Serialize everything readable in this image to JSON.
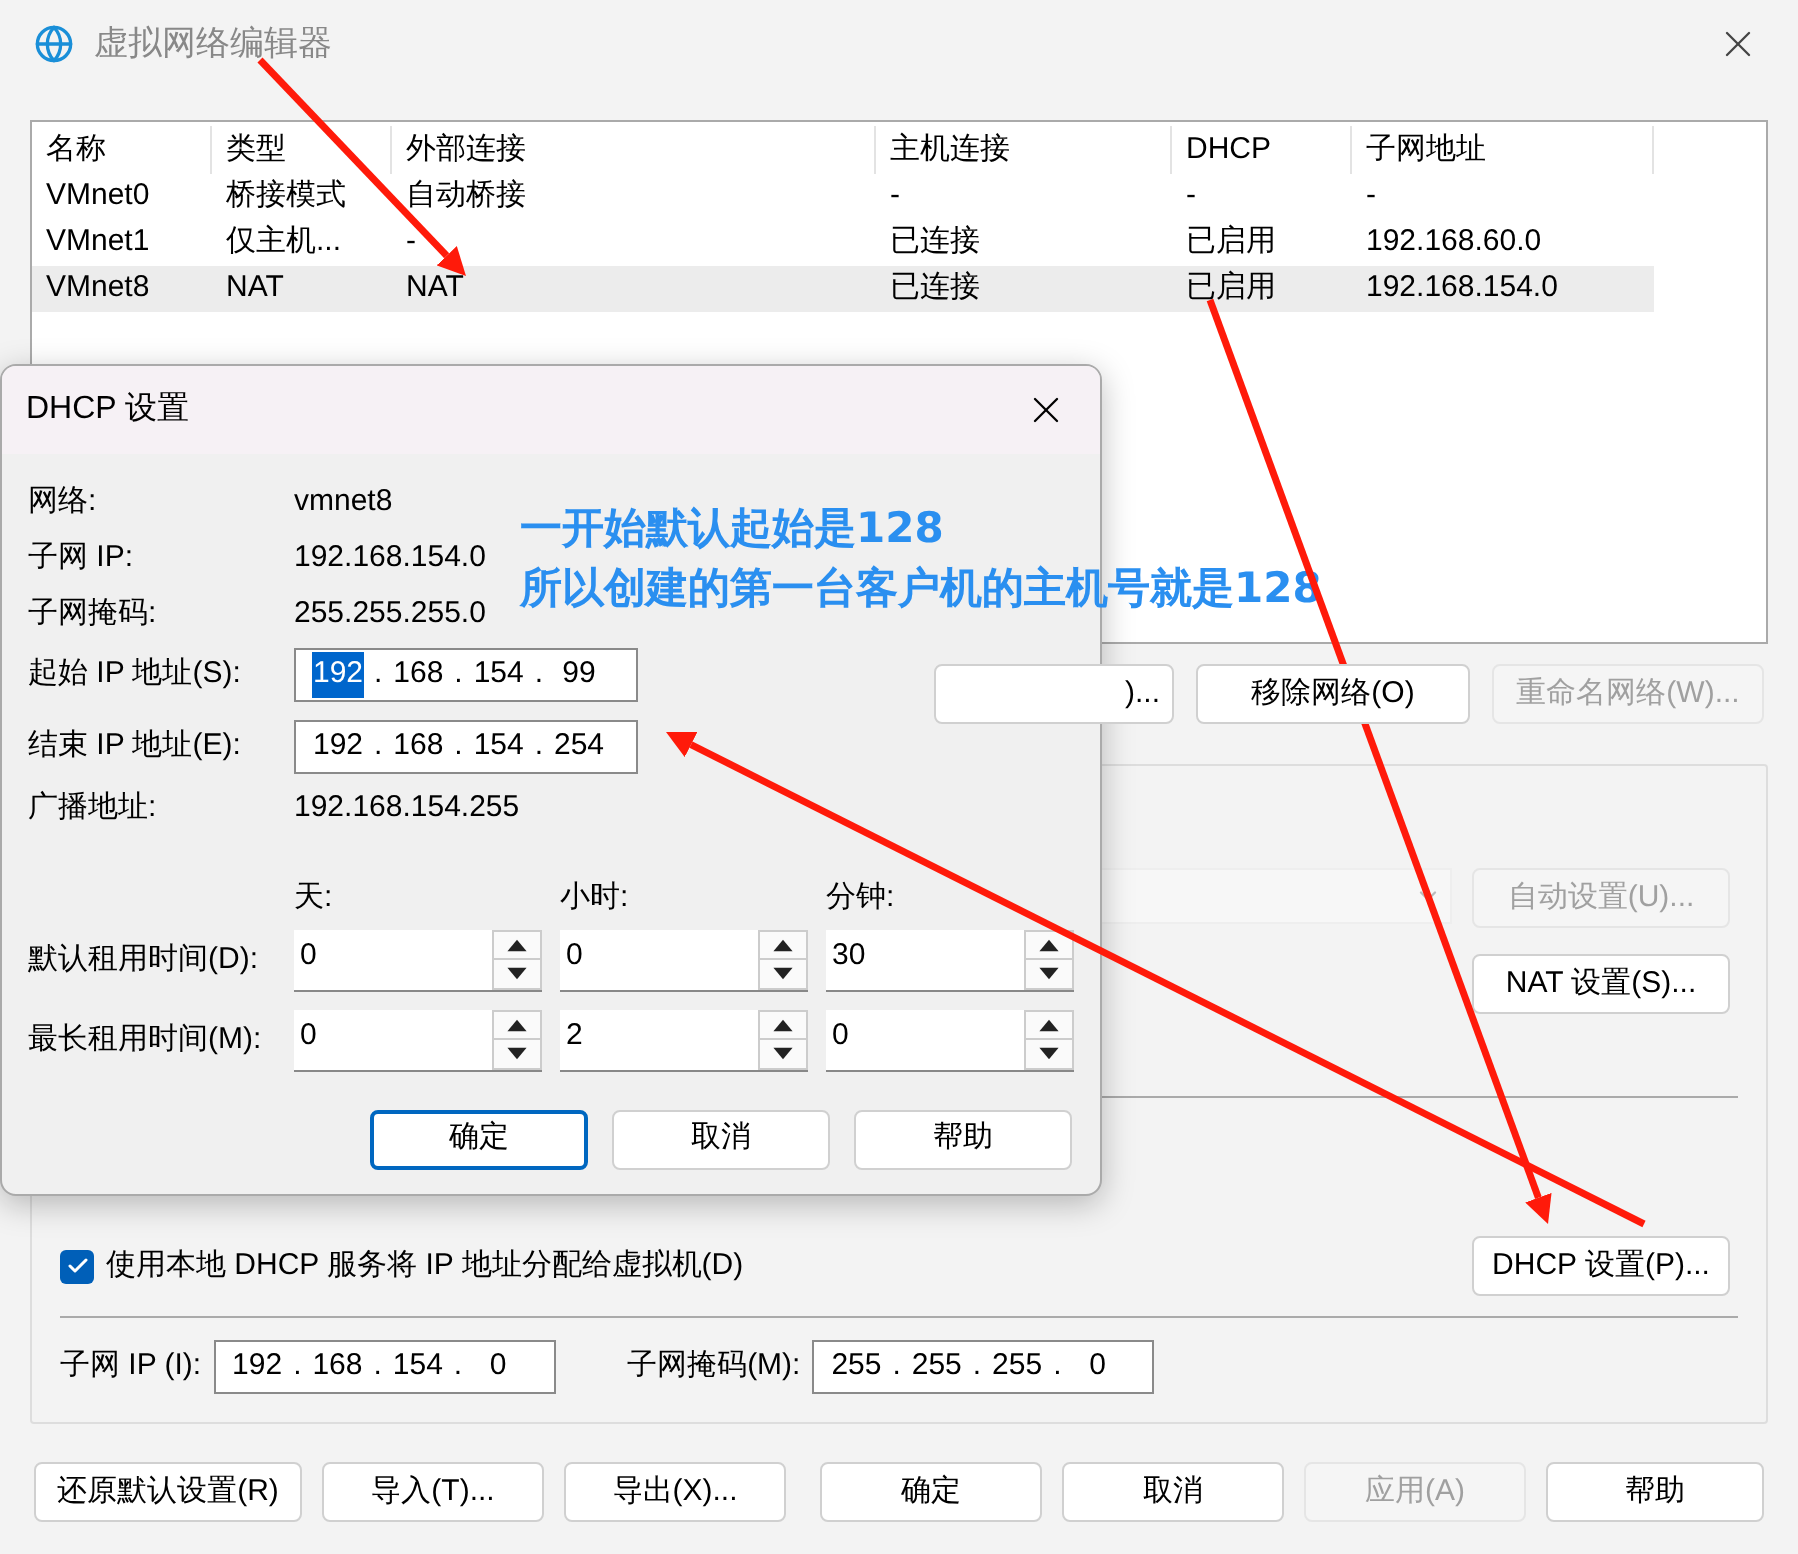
{
  "window": {
    "title": "虚拟网络编辑器"
  },
  "table": {
    "columns": [
      "名称",
      "类型",
      "外部连接",
      "主机连接",
      "DHCP",
      "子网地址"
    ],
    "rows": [
      {
        "cells": [
          "VMnet0",
          "桥接模式",
          "自动桥接",
          "-",
          "-",
          "-"
        ],
        "selected": false
      },
      {
        "cells": [
          "VMnet1",
          "仅主机...",
          "-",
          "已连接",
          "已启用",
          "192.168.60.0"
        ],
        "selected": false
      },
      {
        "cells": [
          "VMnet8",
          "NAT",
          "NAT",
          "已连接",
          "已启用",
          "192.168.154.0"
        ],
        "selected": true
      }
    ]
  },
  "network_buttons": [
    {
      "label": ")...",
      "disabled": false
    },
    {
      "label": "移除网络(O)",
      "disabled": false
    },
    {
      "label": "重命名网络(W)...",
      "disabled": true
    }
  ],
  "settings": {
    "auto_button": {
      "label": "自动设置(U)...",
      "disabled": true
    },
    "nat_button": {
      "label": "NAT 设置(S)...",
      "disabled": false
    },
    "dhcp_checkbox": {
      "label": "使用本地 DHCP 服务将 IP 地址分配给虚拟机(D)",
      "checked": true
    },
    "dhcp_button": {
      "label": "DHCP 设置(P)...",
      "disabled": false
    },
    "subnet_ip": {
      "label": "子网 IP (I):",
      "segments": [
        "192",
        "168",
        "154",
        "0"
      ]
    },
    "subnet_mask": {
      "label": "子网掩码(M):",
      "segments": [
        "255",
        "255",
        "255",
        "0"
      ]
    },
    "separator": "."
  },
  "bottom_buttons": [
    {
      "label": "还原默认设置(R)",
      "disabled": false
    },
    {
      "label": "导入(T)...",
      "disabled": false
    },
    {
      "label": "导出(X)...",
      "disabled": false
    },
    {
      "label": "确定",
      "disabled": false
    },
    {
      "label": "取消",
      "disabled": false
    },
    {
      "label": "应用(A)",
      "disabled": true
    },
    {
      "label": "帮助",
      "disabled": false
    }
  ],
  "dhcp_dialog": {
    "title": "DHCP 设置",
    "info": [
      {
        "label": "网络:",
        "value": "vmnet8"
      },
      {
        "label": "子网 IP:",
        "value": "192.168.154.0"
      },
      {
        "label": "子网掩码:",
        "value": "255.255.255.0"
      }
    ],
    "separator": ".",
    "start_ip": {
      "label": "起始 IP 地址(S):",
      "segments": [
        {
          "text": "192",
          "selected": true
        },
        {
          "text": "168",
          "selected": false
        },
        {
          "text": "154",
          "selected": false
        },
        {
          "text": "99",
          "selected": false
        }
      ]
    },
    "end_ip": {
      "label": "结束 IP 地址(E):",
      "segments": [
        {
          "text": "192",
          "selected": false
        },
        {
          "text": "168",
          "selected": false
        },
        {
          "text": "154",
          "selected": false
        },
        {
          "text": "254",
          "selected": false
        }
      ]
    },
    "broadcast": {
      "label": "广播地址:",
      "value": "192.168.154.255"
    },
    "lease_headers": [
      "天:",
      "小时:",
      "分钟:"
    ],
    "leases": [
      {
        "label": "默认租用时间(D):",
        "values": [
          "0",
          "0",
          "30"
        ]
      },
      {
        "label": "最长租用时间(M):",
        "values": [
          "0",
          "2",
          "0"
        ]
      }
    ],
    "buttons": [
      {
        "label": "确定",
        "default": true
      },
      {
        "label": "取消",
        "default": false
      },
      {
        "label": "帮助",
        "default": false
      }
    ]
  },
  "annotation": [
    "一开始默认起始是128",
    "所以创建的第一台客户机的主机号就是128"
  ]
}
